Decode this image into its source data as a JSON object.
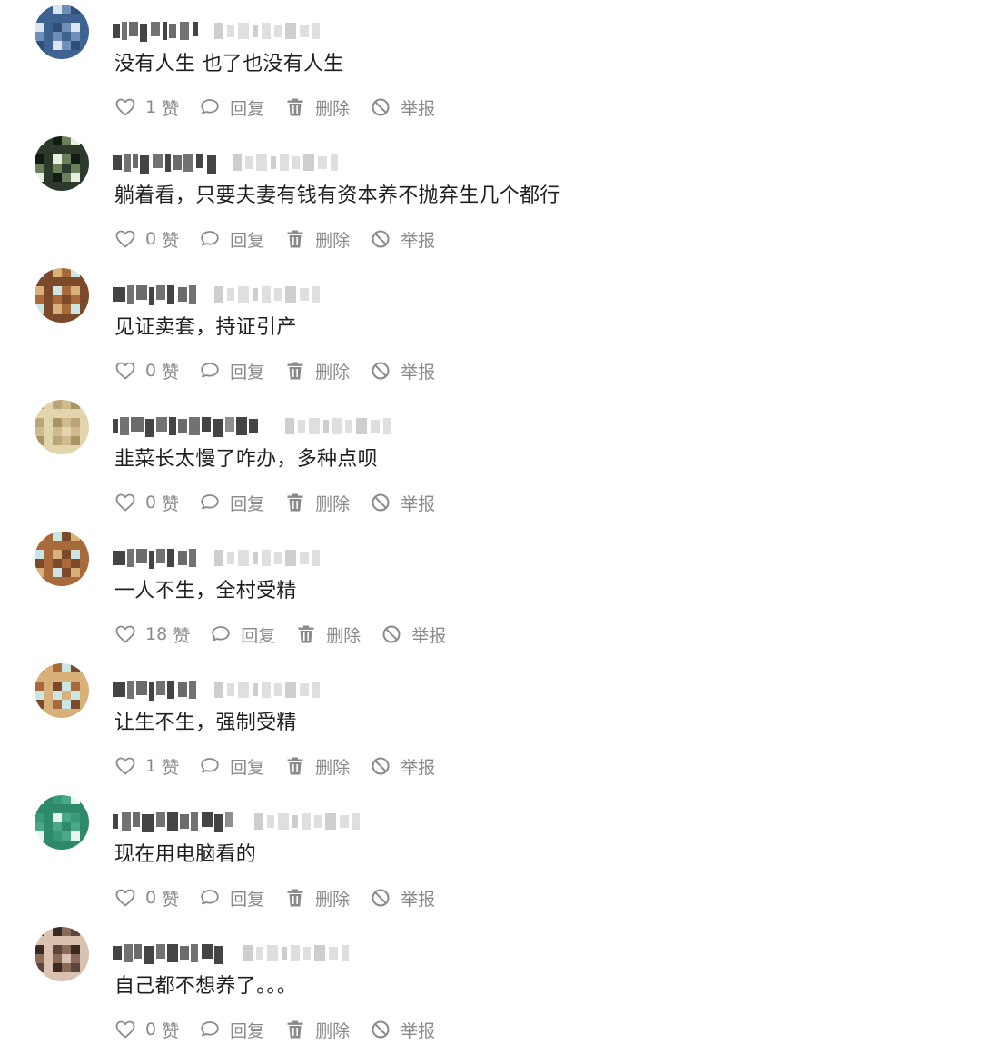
{
  "labels": {
    "like_unit": "赞",
    "reply": "回复",
    "delete": "删除",
    "report": "举报"
  },
  "colors": {
    "text": "#1f1f1f",
    "meta_gray": "#8a8a8a",
    "icon_gray": "#8a8a8a",
    "username_blur": "#3a3a3a",
    "timestamp_blur": "#c9c9c9"
  },
  "icons": {
    "like": "heart-outline-icon",
    "reply": "speech-bubble-icon",
    "delete": "trash-can-icon",
    "report": "prohibited-circle-icon"
  },
  "comments": [
    {
      "username": "",
      "timestamp": "",
      "text": "没有人生 也了也没有人生",
      "likes": "1",
      "avatar_palette": [
        "#2f4f7a",
        "#6f8fb8",
        "#dbe4ef",
        "#3f6390"
      ]
    },
    {
      "username": "",
      "timestamp": "",
      "text": "躺着看，只要夫妻有钱有资本养不抛弃生几个都行",
      "likes": "0",
      "avatar_palette": [
        "#2b3a2b",
        "#e8efe0",
        "#6b7f5a",
        "#141b14"
      ]
    },
    {
      "username": "",
      "timestamp": "",
      "text": "见证卖套，持证引产",
      "likes": "0",
      "avatar_palette": [
        "#d8b07a",
        "#7a4a2a",
        "#c9e6e2",
        "#a86a3a"
      ]
    },
    {
      "username": "",
      "timestamp": "",
      "text": "韭菜长太慢了咋办，多种点呗",
      "likes": "0",
      "avatar_palette": [
        "#cdbb8e",
        "#b9a577",
        "#e2d4ac",
        "#a89563"
      ]
    },
    {
      "username": "",
      "timestamp": "",
      "text": "一人不生，全村受精",
      "likes": "18",
      "avatar_palette": [
        "#d8b07a",
        "#7a4a2a",
        "#c9e6e2",
        "#a86a3a"
      ]
    },
    {
      "username": "",
      "timestamp": "",
      "text": "让生不生，强制受精",
      "likes": "1",
      "avatar_palette": [
        "#d8b07a",
        "#7a4a2a",
        "#c9e6e2",
        "#a86a3a"
      ]
    },
    {
      "username": "",
      "timestamp": "",
      "text": "现在用电脑看的",
      "likes": "0",
      "avatar_palette": [
        "#3a9a78",
        "#2e8a6a",
        "#e8f4ef",
        "#4aa887"
      ]
    },
    {
      "username": "",
      "timestamp": "",
      "text": "自己都不想养了。。。",
      "likes": "0",
      "avatar_palette": [
        "#8a6a58",
        "#3a2a24",
        "#d9c2b0",
        "#5a463c"
      ]
    }
  ]
}
